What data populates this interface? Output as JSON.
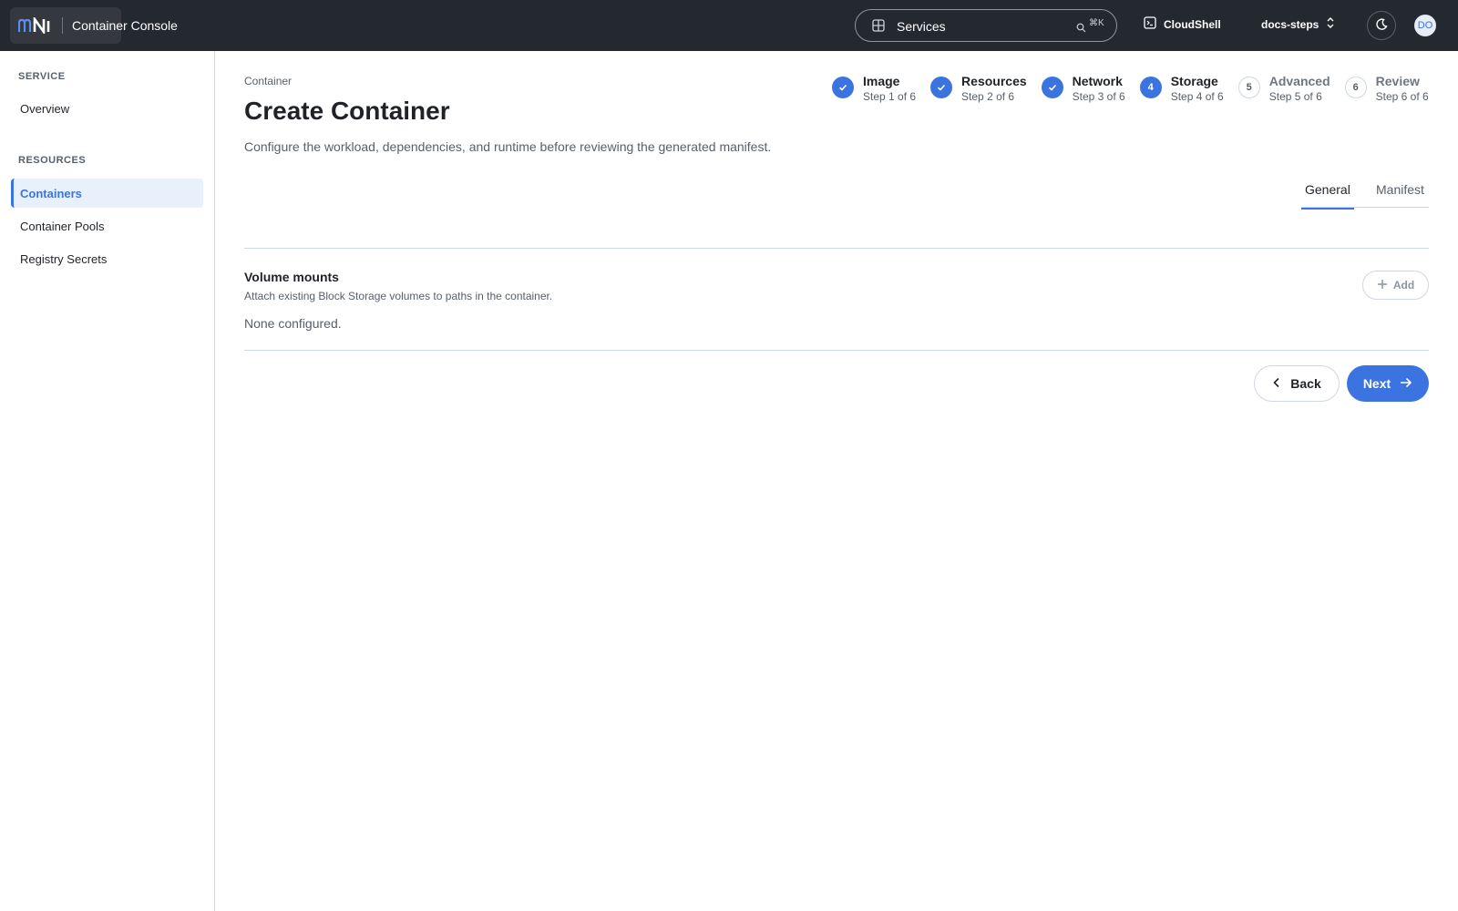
{
  "topbar": {
    "app_title": "Container Console",
    "search": {
      "label": "Services",
      "shortcut": "⌘K"
    },
    "cloudshell_label": "CloudShell",
    "project_label": "docs-steps",
    "avatar_initials": "DO"
  },
  "sidebar": {
    "sections": [
      {
        "heading": "SERVICE",
        "items": [
          {
            "label": "Overview",
            "active": false
          }
        ]
      },
      {
        "heading": "RESOURCES",
        "items": [
          {
            "label": "Containers",
            "active": true
          },
          {
            "label": "Container Pools",
            "active": false
          },
          {
            "label": "Registry Secrets",
            "active": false
          }
        ]
      }
    ]
  },
  "page": {
    "breadcrumb": "Container",
    "title": "Create Container",
    "description": "Configure the workload, dependencies, and runtime before reviewing the generated manifest."
  },
  "stepper": {
    "steps": [
      {
        "number": "1",
        "name": "Image",
        "sub": "Step 1 of 6",
        "state": "done"
      },
      {
        "number": "2",
        "name": "Resources",
        "sub": "Step 2 of 6",
        "state": "done"
      },
      {
        "number": "3",
        "name": "Network",
        "sub": "Step 3 of 6",
        "state": "done"
      },
      {
        "number": "4",
        "name": "Storage",
        "sub": "Step 4 of 6",
        "state": "current"
      },
      {
        "number": "5",
        "name": "Advanced",
        "sub": "Step 5 of 6",
        "state": "upcoming"
      },
      {
        "number": "6",
        "name": "Review",
        "sub": "Step 6 of 6",
        "state": "upcoming"
      }
    ]
  },
  "tabs": {
    "general": "General",
    "manifest": "Manifest",
    "active": "General"
  },
  "volume_mounts": {
    "title": "Volume mounts",
    "description": "Attach existing Block Storage volumes to paths in the container.",
    "empty_text": "None configured.",
    "add_label": "Add"
  },
  "footer": {
    "back_label": "Back",
    "next_label": "Next"
  },
  "colors": {
    "accent": "#3b73e0",
    "topbar_bg": "#24292f"
  }
}
